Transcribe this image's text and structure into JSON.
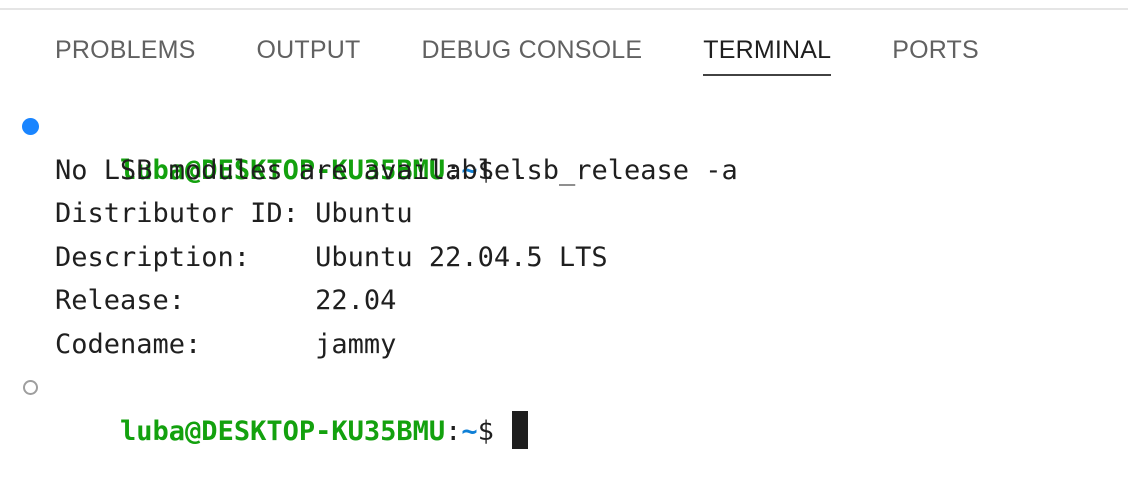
{
  "panel": {
    "tabs": [
      {
        "label": "PROBLEMS",
        "active": false
      },
      {
        "label": "OUTPUT",
        "active": false
      },
      {
        "label": "DEBUG CONSOLE",
        "active": false
      },
      {
        "label": "TERMINAL",
        "active": true
      },
      {
        "label": "PORTS",
        "active": false
      }
    ]
  },
  "terminal": {
    "prompt_user": "luba@DESKTOP-KU35BMU",
    "prompt_colon": ":",
    "prompt_path": "~",
    "prompt_dollar": "$ ",
    "command": "lsb_release -a",
    "output": [
      "No LSB modules are available.",
      "Distributor ID: Ubuntu",
      "Description:    Ubuntu 22.04.5 LTS",
      "Release:        22.04",
      "Codename:       jammy"
    ],
    "decoration_icons": [
      "command-success-icon",
      "command-pending-icon"
    ],
    "colors": {
      "prompt_user": "#13a10e",
      "prompt_path": "#0e7fd6",
      "success_decoration": "#1a85ff"
    }
  }
}
